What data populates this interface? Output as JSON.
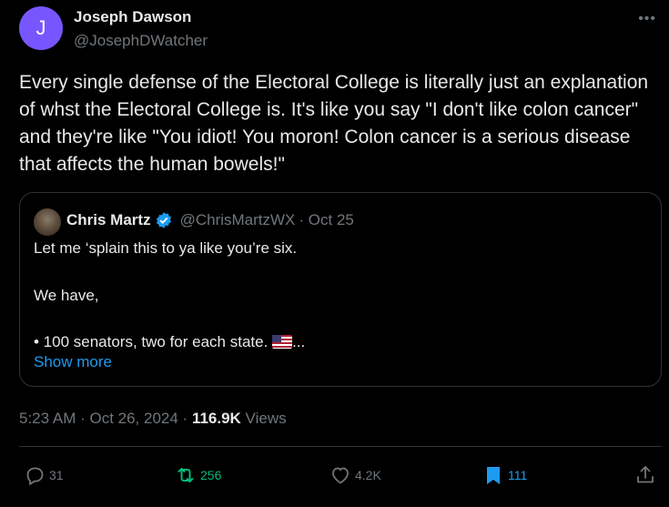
{
  "author": {
    "avatar_initial": "J",
    "name": "Joseph Dawson",
    "handle": "@JosephDWatcher"
  },
  "more_icon": "more-horizontal-icon",
  "tweet_text": "Every single defense of the Electoral College is literally just an explanation of whst the Electoral College is. It's like you say \"I don't like colon cancer\" and they're like \"You idiot! You moron! Colon cancer is a serious disease that affects the human bowels!\"",
  "quote": {
    "name": "Chris Martz",
    "handle": "@ChrisMartzWX",
    "date": "· Oct 25",
    "line1": "Let me ‘splain this to ya like you’re six.",
    "line2": "We have,",
    "line3": "• 100 senators, two for each state.",
    "line3_tail": "...",
    "show_more": "Show more"
  },
  "meta": {
    "time": "5:23 AM · Oct 26, 2024 · ",
    "views_count": "116.9K",
    "views_label": " Views"
  },
  "actions": {
    "replies": "31",
    "reposts": "256",
    "likes": "4.2K",
    "bookmarks": "111"
  },
  "colors": {
    "background": "#000000",
    "text": "#e7e9ea",
    "muted": "#71767b",
    "accent_blue": "#1d9bf0",
    "repost_green": "#00ba7c",
    "avatar_purple": "#7856ff"
  }
}
